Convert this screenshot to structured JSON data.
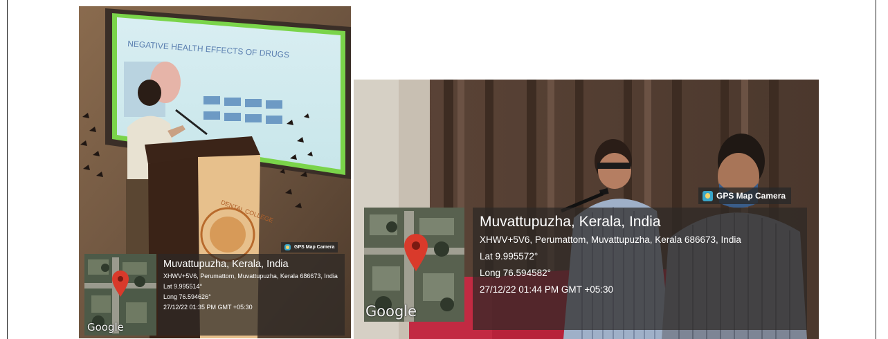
{
  "photos": [
    {
      "badge_label": "GPS Map Camera",
      "map_label": "Google",
      "title": "Muvattupuzha, Kerala, India",
      "address": "XHWV+5V6, Perumattom, Muvattupuzha, Kerala 686673, India",
      "lat": "Lat 9.995514°",
      "long": "Long 76.594626°",
      "timestamp": "27/12/22 01:35 PM GMT +05:30",
      "slide_title": "NEGATIVE HEALTH EFFECTS OF DRUGS",
      "podium_text": "DENTAL COLLEGE"
    },
    {
      "badge_label": "GPS Map Camera",
      "map_label": "Google",
      "title": "Muvattupuzha, Kerala, India",
      "address": "XHWV+5V6, Perumattom, Muvattupuzha, Kerala 686673, India",
      "lat": "Lat 9.995572°",
      "long": "Long 76.594582°",
      "timestamp": "27/12/22 01:44 PM GMT +05:30"
    }
  ],
  "colors": {
    "overlay_bg": "#2d2826",
    "pin_red": "#d93a2b",
    "slide_green": "#7ad44a",
    "podium_brown": "#4a2d1e"
  }
}
